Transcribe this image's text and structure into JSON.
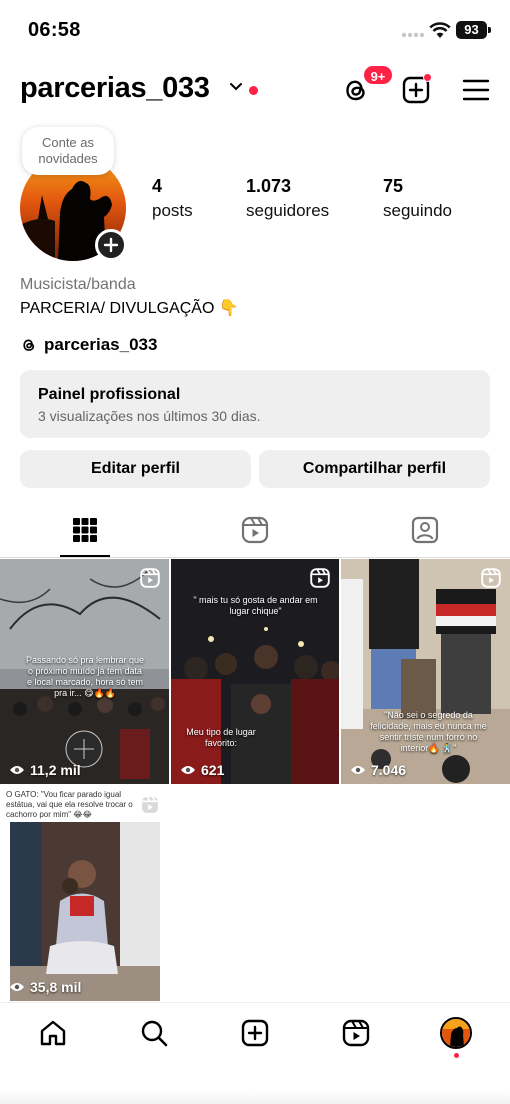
{
  "status_bar": {
    "time": "06:58",
    "battery": "93"
  },
  "header": {
    "username": "parcerias_033",
    "threads_badge": "9+",
    "icons": [
      "threads-icon",
      "add-post-icon",
      "menu-icon"
    ]
  },
  "profile": {
    "note": "Conte as novidades",
    "stats": [
      {
        "value": "4",
        "label": "posts"
      },
      {
        "value": "1.073",
        "label": "seguidores"
      },
      {
        "value": "75",
        "label": "seguindo"
      }
    ],
    "category": "Musicista/banda",
    "bio": "PARCERIA/ DIVULGAÇÃO 👇",
    "threads_handle": "parcerias_033"
  },
  "professional_panel": {
    "title": "Painel profissional",
    "subtitle": "3 visualizações nos últimos 30 dias."
  },
  "buttons": {
    "edit": "Editar perfil",
    "share": "Compartilhar perfil"
  },
  "tabs": [
    "grid-icon",
    "reels-icon",
    "tagged-icon"
  ],
  "posts": [
    {
      "views": "11,2 mil",
      "caption": "Passando só pra lembrar que o próximo muído já tem data e local marcado, hora só tem pra ir... 😋🔥🔥"
    },
    {
      "views": "621",
      "caption_top": "\" mais tu só gosta de andar em lugar chique\"",
      "caption_bottom": "Meu tipo de lugar favorito:"
    },
    {
      "views": "7.046",
      "caption": "\"Não sei o segredo da felicidade, mais eu nunca me sentir triste num forró no interior🔥 🕺\""
    },
    {
      "views": "35,8 mil",
      "caption": "O GATO: \"Vou ficar parado igual estátua, vai que ela resolve trocar o cachorro por mim\" 😂😂"
    }
  ],
  "nav": [
    "home-icon",
    "search-icon",
    "create-icon",
    "reels-icon",
    "profile-avatar"
  ],
  "colors": {
    "accent_red": "#ff2146",
    "button_bg": "#efefef",
    "secondary_text": "#737373"
  }
}
